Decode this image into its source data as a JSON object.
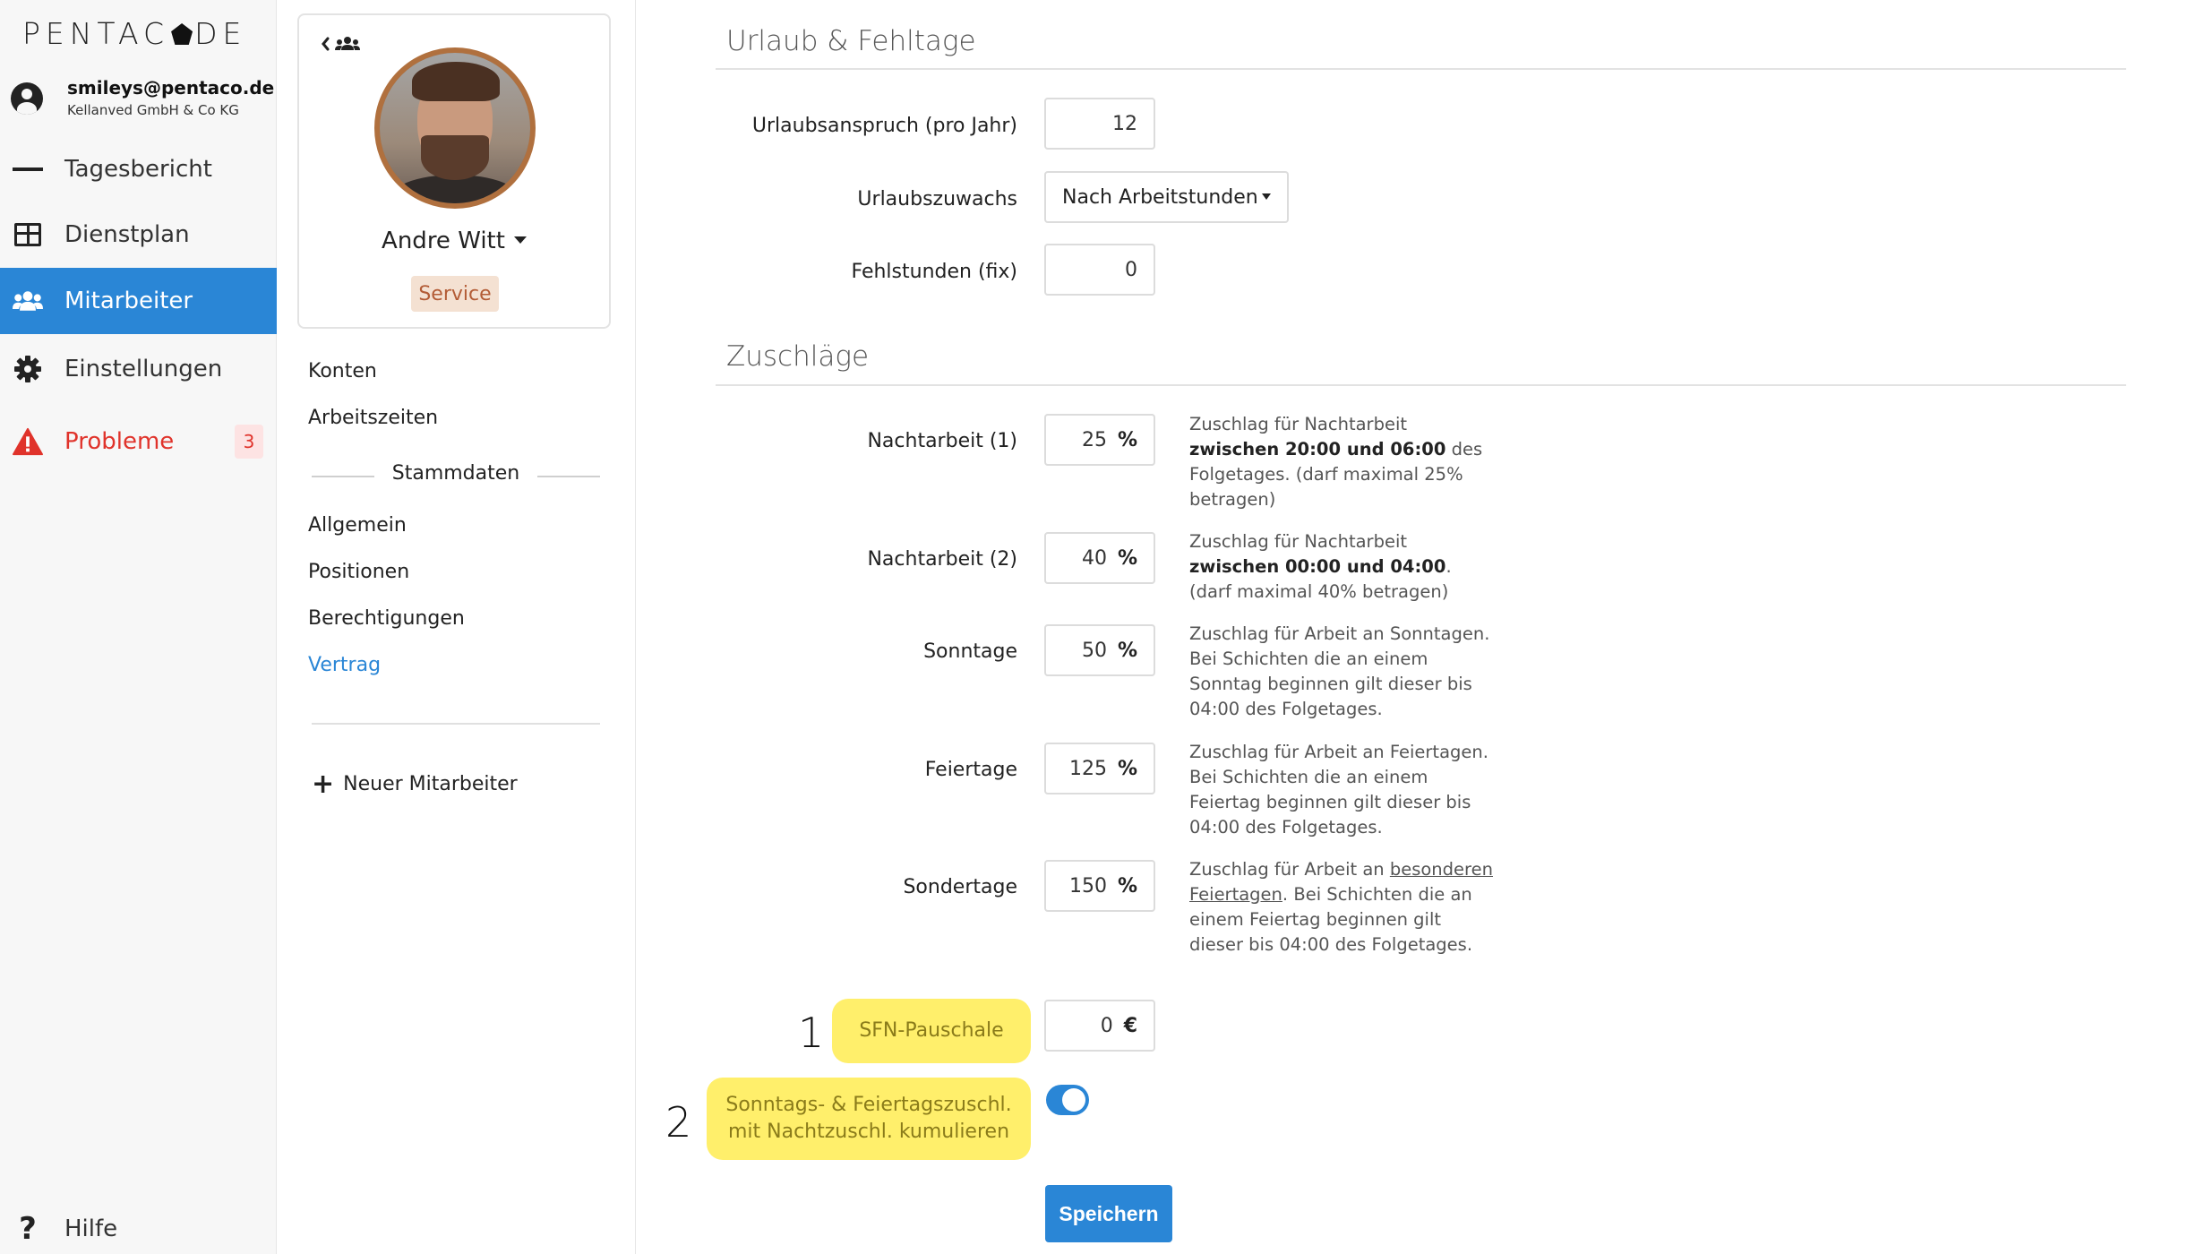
{
  "app": {
    "logo_text_left": "PENTAC",
    "logo_text_right": "DE"
  },
  "user": {
    "email": "smileys@pentaco.de",
    "company": "Kellanved GmbH & Co KG"
  },
  "nav": {
    "items": [
      {
        "label": "Tagesbericht",
        "icon": "list-icon"
      },
      {
        "label": "Dienstplan",
        "icon": "table-icon"
      },
      {
        "label": "Mitarbeiter",
        "icon": "users-icon",
        "active": true
      },
      {
        "label": "Einstellungen",
        "icon": "gear-icon"
      },
      {
        "label": "Probleme",
        "icon": "warning-icon",
        "badge": "3"
      }
    ],
    "help_label": "Hilfe"
  },
  "employee": {
    "name": "Andre Witt",
    "role": "Service"
  },
  "submenu": {
    "konten": "Konten",
    "arbeitszeiten": "Arbeitszeiten",
    "stammdaten": "Stammdaten",
    "allgemein": "Allgemein",
    "positionen": "Positionen",
    "berechtigungen": "Berechtigungen",
    "vertrag": "Vertrag",
    "new_employee": "Neuer Mitarbeiter"
  },
  "urlaub": {
    "title": "Urlaub & Fehltage",
    "anspruch_label": "Urlaubsanspruch (pro Jahr)",
    "anspruch_value": "12",
    "zuwachs_label": "Urlaubszuwachs",
    "zuwachs_value": "Nach Arbeitstunden",
    "fehlstunden_label": "Fehlstunden (fix)",
    "fehlstunden_value": "0"
  },
  "zuschlaege": {
    "title": "Zuschläge",
    "rows": [
      {
        "label": "Nachtarbeit (1)",
        "value": "25",
        "unit": "%",
        "help_pre": "Zuschlag für Nachtarbeit ",
        "help_bold": "zwischen 20:00 und 06:00",
        "help_post": " des Folgetages. (darf maximal 25% betragen)"
      },
      {
        "label": "Nachtarbeit (2)",
        "value": "40",
        "unit": "%",
        "help_pre": "Zuschlag für Nachtarbeit ",
        "help_bold": "zwischen 00:00 und 04:00",
        "help_post": ". (darf maximal 40% betragen)"
      },
      {
        "label": "Sonntage",
        "value": "50",
        "unit": "%",
        "help_pre": "Zuschlag für Arbeit an Sonntagen. Bei Schichten die an einem Sonntag beginnen gilt dieser bis 04:00 des Folgetages."
      },
      {
        "label": "Feiertage",
        "value": "125",
        "unit": "%",
        "help_pre": "Zuschlag für Arbeit an Feiertagen. Bei Schichten die an einem Feiertag beginnen gilt dieser bis 04:00 des Folgetages."
      },
      {
        "label": "Sondertage",
        "value": "150",
        "unit": "%",
        "help_pre": "Zuschlag für Arbeit an ",
        "help_link": "besonderen Feiertagen",
        "help_post": ". Bei Schichten die an einem Feiertag beginnen gilt dieser bis 04:00 des Folgetages."
      }
    ],
    "sfn_number": "1",
    "sfn_label": "SFN-Pauschale",
    "sfn_value": "0",
    "sfn_unit": "€",
    "kumulieren_number": "2",
    "kumulieren_label_line1": "Sonntags- & Feiertagszuschl.",
    "kumulieren_label_line2": "mit Nachtzuschl. kumulieren",
    "kumulieren_on": true
  },
  "actions": {
    "save_label": "Speichern"
  },
  "colors": {
    "accent": "#2a86d6",
    "danger": "#e0332b",
    "highlight": "#ffef6b"
  }
}
